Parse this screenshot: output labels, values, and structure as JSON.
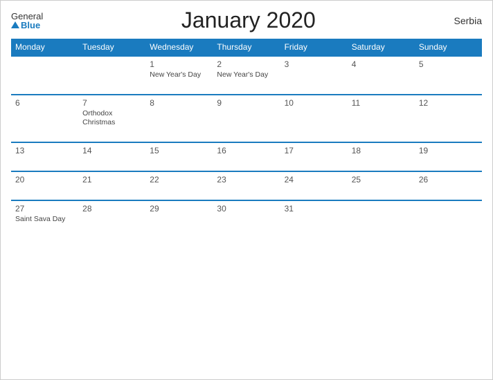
{
  "header": {
    "logo_general": "General",
    "logo_blue": "Blue",
    "title": "January 2020",
    "country": "Serbia"
  },
  "weekdays": [
    "Monday",
    "Tuesday",
    "Wednesday",
    "Thursday",
    "Friday",
    "Saturday",
    "Sunday"
  ],
  "weeks": [
    [
      {
        "day": "",
        "holiday": ""
      },
      {
        "day": "",
        "holiday": ""
      },
      {
        "day": "1",
        "holiday": "New Year's Day"
      },
      {
        "day": "2",
        "holiday": "New Year's Day"
      },
      {
        "day": "3",
        "holiday": ""
      },
      {
        "day": "4",
        "holiday": ""
      },
      {
        "day": "5",
        "holiday": ""
      }
    ],
    [
      {
        "day": "6",
        "holiday": ""
      },
      {
        "day": "7",
        "holiday": "Orthodox Christmas"
      },
      {
        "day": "8",
        "holiday": ""
      },
      {
        "day": "9",
        "holiday": ""
      },
      {
        "day": "10",
        "holiday": ""
      },
      {
        "day": "11",
        "holiday": ""
      },
      {
        "day": "12",
        "holiday": ""
      }
    ],
    [
      {
        "day": "13",
        "holiday": ""
      },
      {
        "day": "14",
        "holiday": ""
      },
      {
        "day": "15",
        "holiday": ""
      },
      {
        "day": "16",
        "holiday": ""
      },
      {
        "day": "17",
        "holiday": ""
      },
      {
        "day": "18",
        "holiday": ""
      },
      {
        "day": "19",
        "holiday": ""
      }
    ],
    [
      {
        "day": "20",
        "holiday": ""
      },
      {
        "day": "21",
        "holiday": ""
      },
      {
        "day": "22",
        "holiday": ""
      },
      {
        "day": "23",
        "holiday": ""
      },
      {
        "day": "24",
        "holiday": ""
      },
      {
        "day": "25",
        "holiday": ""
      },
      {
        "day": "26",
        "holiday": ""
      }
    ],
    [
      {
        "day": "27",
        "holiday": "Saint Sava Day"
      },
      {
        "day": "28",
        "holiday": ""
      },
      {
        "day": "29",
        "holiday": ""
      },
      {
        "day": "30",
        "holiday": ""
      },
      {
        "day": "31",
        "holiday": ""
      },
      {
        "day": "",
        "holiday": ""
      },
      {
        "day": "",
        "holiday": ""
      }
    ]
  ]
}
